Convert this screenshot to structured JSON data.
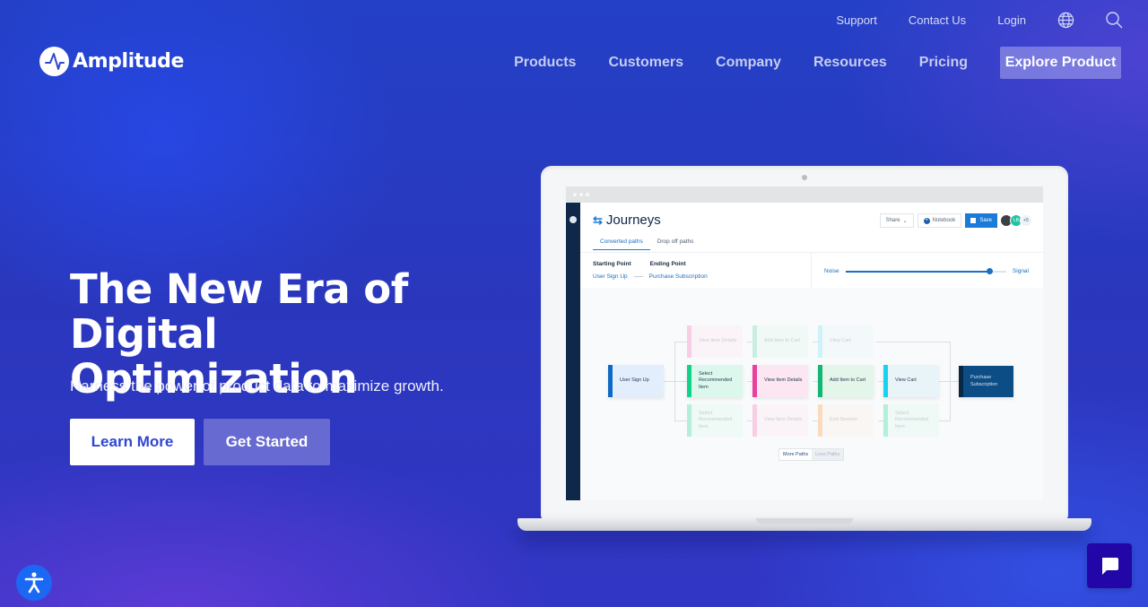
{
  "brand": {
    "name": "Amplitude"
  },
  "utility_nav": {
    "links": [
      "Support",
      "Contact Us",
      "Login"
    ],
    "icons": [
      "globe-icon",
      "search-icon"
    ]
  },
  "main_nav": {
    "items": [
      "Products",
      "Customers",
      "Company",
      "Resources",
      "Pricing"
    ],
    "cta": "Explore Product"
  },
  "hero": {
    "title_line1": "The New Era of",
    "title_line2": "Digital Optimization",
    "subtitle": "Harness the power of product data to maximize growth.",
    "primary_button": "Learn More",
    "secondary_button": "Get Started"
  },
  "app_preview": {
    "title": "Journeys",
    "actions": {
      "share": "Share",
      "notebook": "Notebook",
      "save": "Save",
      "avatar_initials": "LB",
      "more_avatars": "+5"
    },
    "tabs": [
      {
        "label": "Converted paths",
        "active": true
      },
      {
        "label": "Drop off paths",
        "active": false
      }
    ],
    "starting_point_label": "Starting Point",
    "ending_point_label": "Ending Point",
    "starting_point_value": "User Sign Up",
    "ending_point_value": "Purchase Subscription",
    "slider": {
      "left_label": "Noise",
      "right_label": "Signal",
      "value_percent": 90
    },
    "flow": {
      "start": "User Sign Up",
      "end": "Purchase Subscription",
      "rows": [
        {
          "faded": true,
          "steps": [
            "View Item Details",
            "Add Item to Cart",
            "View Cart"
          ]
        },
        {
          "faded": false,
          "steps": [
            "Select Recommended Item",
            "View Item Details",
            "Add Item to Cart",
            "View Cart"
          ]
        },
        {
          "faded": true,
          "steps": [
            "Select Recommended Item",
            "View Item Details",
            "End Session",
            "Select Recommended Item"
          ]
        }
      ]
    },
    "paths_toggle": {
      "more": "More Paths",
      "less": "Less Paths"
    }
  },
  "colors": {
    "accent_blue": "#1a7bd8",
    "cta_text": "#2f46d4",
    "chat_button": "#2306a8",
    "accessibility_button": "#1b68f5"
  }
}
